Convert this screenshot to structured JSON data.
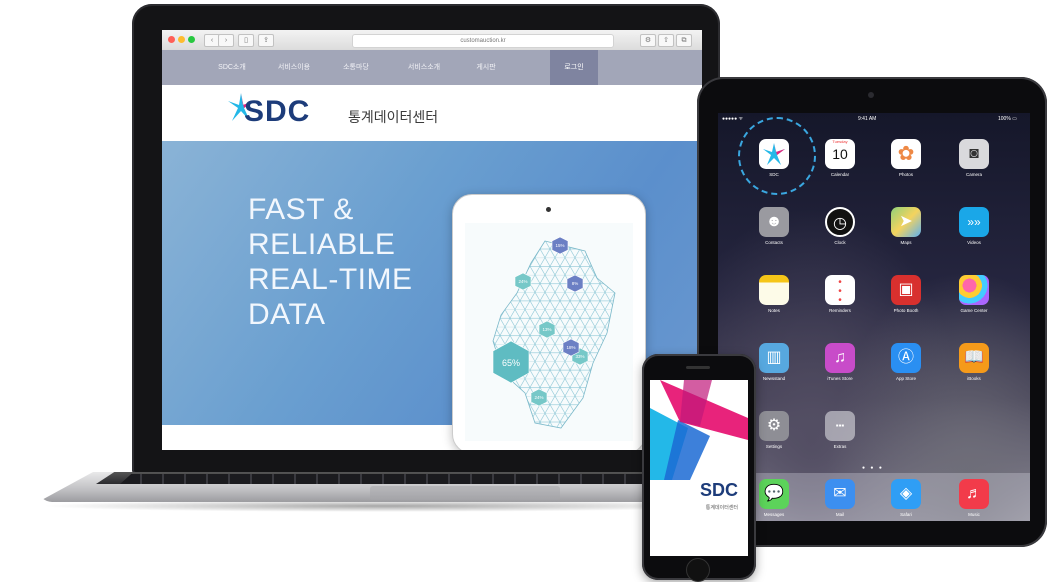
{
  "browser": {
    "url": "customauction.kr",
    "buttons": [
      "‹",
      "›",
      "▯",
      "⇪"
    ],
    "right_buttons": [
      "⚙",
      "⇧",
      "⧉"
    ],
    "traffic_colors": [
      "#ff5f57",
      "#febc2e",
      "#28c840"
    ]
  },
  "site": {
    "nav": [
      "SDC소개",
      "서비스이용",
      "소통마당",
      "서비스소개",
      "게시판"
    ],
    "nav_login": "로그인",
    "logo": "SDC",
    "logo_sub": "통계데이터센터",
    "hero_lines": [
      "FAST &",
      "RELIABLE",
      "REAL-TIME",
      "DATA"
    ],
    "map_labels": [
      "15%",
      "24%",
      "8%",
      "13%",
      "18%",
      "33%",
      "65%",
      "24%"
    ],
    "map_big_label": "65%"
  },
  "ipad": {
    "status_carrier": "●●●●● ᯤ",
    "status_time": "9:41 AM",
    "status_battery": "100% ▭",
    "apps": [
      {
        "label": "SDC",
        "icon": "sdc-app-icon",
        "color": "#ffffff"
      },
      {
        "label": "Calendar",
        "icon": "calendar-icon",
        "color": "#ffffff"
      },
      {
        "label": "Photos",
        "icon": "photos-icon",
        "color": "#ffffff"
      },
      {
        "label": "Camera",
        "icon": "camera-icon",
        "color": "#d9d9dc"
      },
      {
        "label": "Contacts",
        "icon": "contacts-icon",
        "color": "#9a9aa0"
      },
      {
        "label": "Clock",
        "icon": "clock-icon",
        "color": "#111111"
      },
      {
        "label": "Maps",
        "icon": "maps-icon",
        "color": "#8fd17a"
      },
      {
        "label": "Videos",
        "icon": "videos-icon",
        "color": "#1aa7e8"
      },
      {
        "label": "Notes",
        "icon": "notes-icon",
        "color": "#fdfbe8"
      },
      {
        "label": "Reminders",
        "icon": "reminders-icon",
        "color": "#ffffff"
      },
      {
        "label": "Photo Booth",
        "icon": "photo-booth-icon",
        "color": "#d8302e"
      },
      {
        "label": "Game Center",
        "icon": "game-center-icon",
        "color": "#f0f0f2"
      },
      {
        "label": "Newsstand",
        "icon": "newsstand-icon",
        "color": "#57a8df"
      },
      {
        "label": "iTunes Store",
        "icon": "itunes-store-icon",
        "color": "#c84cc9"
      },
      {
        "label": "App Store",
        "icon": "app-store-icon",
        "color": "#2a8ff2"
      },
      {
        "label": "iBooks",
        "icon": "ibooks-icon",
        "color": "#f59a1a"
      },
      {
        "label": "Settings",
        "icon": "settings-icon",
        "color": "#8e8e95"
      },
      {
        "label": "Extras",
        "icon": "extras-folder-icon",
        "color": "#c9c8cd"
      }
    ],
    "calendar_day": "Tuesday",
    "calendar_date": "10",
    "dock": [
      {
        "label": "Messages",
        "icon": "messages-icon",
        "color": "#5cd35a"
      },
      {
        "label": "Mail",
        "icon": "mail-icon",
        "color": "#3c8ff0"
      },
      {
        "label": "Safari",
        "icon": "safari-icon",
        "color": "#2f9ef5"
      },
      {
        "label": "Music",
        "icon": "music-icon",
        "color": "#f23b4a"
      }
    ]
  },
  "iphone": {
    "logo": "SDC",
    "sub": "통계데이터센터"
  },
  "colors": {
    "brand_navy": "#1d3c7a",
    "brand_pink": "#e8237b",
    "brand_cyan": "#23b8e8",
    "nav_bg": "#a2a6b8"
  }
}
